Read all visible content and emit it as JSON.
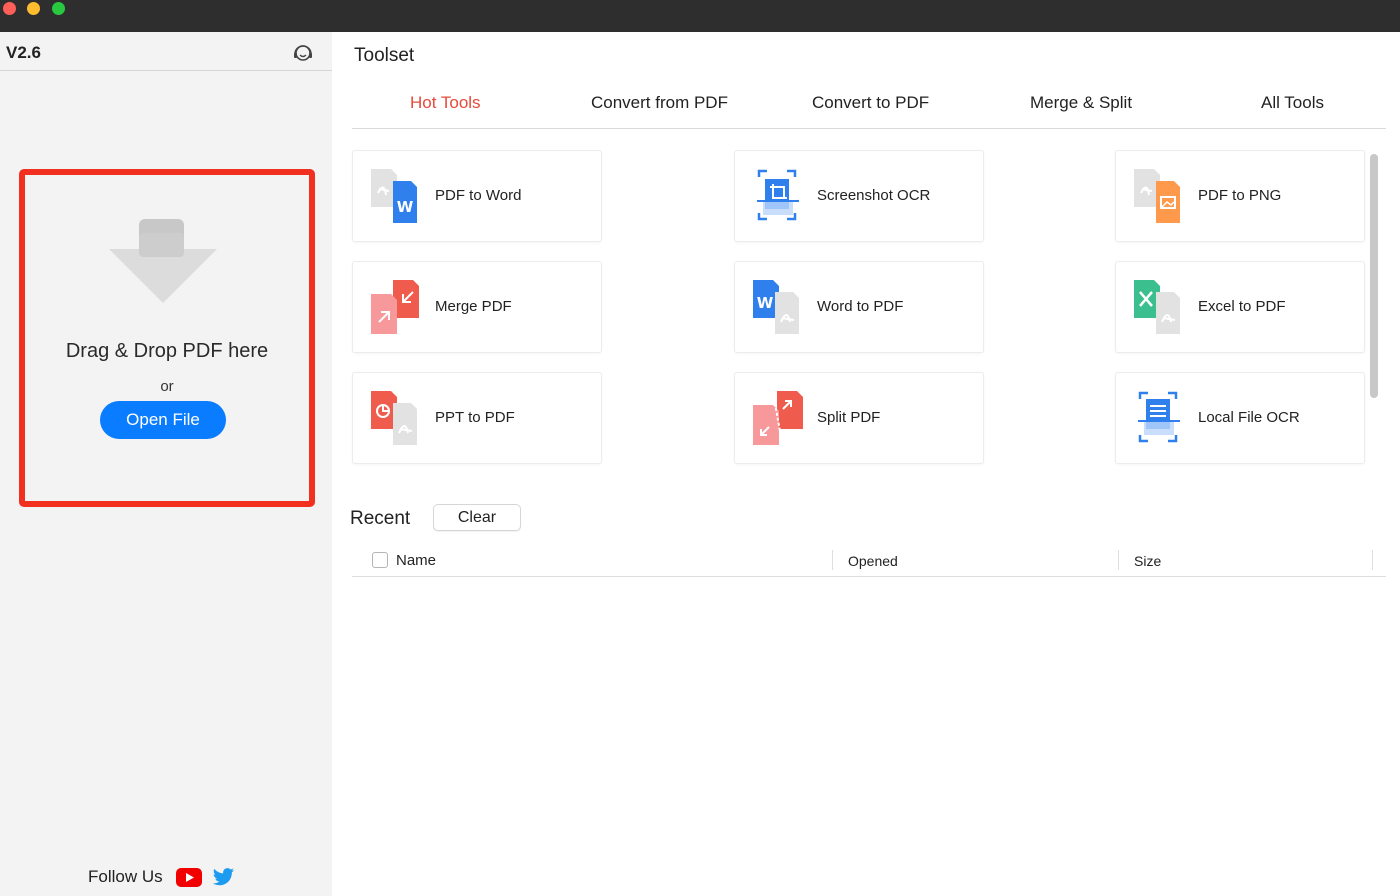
{
  "app": {
    "version": "V2.6"
  },
  "sidebar": {
    "drop_text": "Drag & Drop PDF here",
    "or_text": "or",
    "open_file_label": "Open File",
    "follow_us": "Follow Us",
    "icons": [
      "support-headset-icon",
      "download-arrow-icon",
      "youtube-icon",
      "twitter-icon"
    ]
  },
  "toolset": {
    "title": "Toolset",
    "tabs": [
      {
        "label": "Hot Tools",
        "active": true
      },
      {
        "label": "Convert from PDF",
        "active": false
      },
      {
        "label": "Convert to PDF",
        "active": false
      },
      {
        "label": "Merge & Split",
        "active": false
      },
      {
        "label": "All Tools",
        "active": false
      }
    ],
    "tools": [
      {
        "label": "PDF to Word",
        "icon": "pdf-to-word-icon"
      },
      {
        "label": "Screenshot OCR",
        "icon": "screenshot-ocr-icon"
      },
      {
        "label": "PDF to PNG",
        "icon": "pdf-to-png-icon"
      },
      {
        "label": "Merge PDF",
        "icon": "merge-pdf-icon"
      },
      {
        "label": "Word to PDF",
        "icon": "word-to-pdf-icon"
      },
      {
        "label": "Excel to PDF",
        "icon": "excel-to-pdf-icon"
      },
      {
        "label": "PPT to PDF",
        "icon": "ppt-to-pdf-icon"
      },
      {
        "label": "Split PDF",
        "icon": "split-pdf-icon"
      },
      {
        "label": "Local File OCR",
        "icon": "local-file-ocr-icon"
      }
    ]
  },
  "recent": {
    "title": "Recent",
    "clear_label": "Clear",
    "columns": {
      "name": "Name",
      "opened": "Opened",
      "size": "Size"
    },
    "rows": []
  },
  "colors": {
    "accent": "#0a7cff",
    "active_tab": "#e64a3b",
    "highlight_border": "#f2301f",
    "sidebar_bg": "#f3f3f3"
  }
}
